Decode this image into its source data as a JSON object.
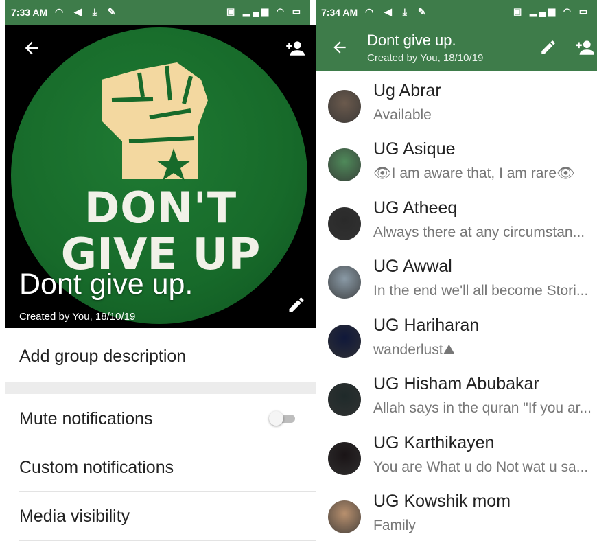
{
  "left": {
    "status_bar": {
      "time": "7:33 AM"
    },
    "poster": {
      "line1": "DON'T",
      "line2": "GIVE UP"
    },
    "group_name": "Dont give up.",
    "created": "Created by You, 18/10/19",
    "description_label": "Add group description",
    "mute_label": "Mute notifications",
    "mute_enabled": false,
    "custom_label": "Custom notifications",
    "media_label": "Media visibility"
  },
  "right": {
    "status_bar": {
      "time": "7:34 AM"
    },
    "header": {
      "title": "Dont give up.",
      "subtitle": "Created by You, 18/10/19"
    },
    "members": [
      {
        "name": "Ug Abrar",
        "status": "Available",
        "avatar_color": "#6b5a4d"
      },
      {
        "name": "UG Asique",
        "status": "👁I am aware that, I am rare👁",
        "avatar_color": "#4f8a5a"
      },
      {
        "name": "UG Atheeq",
        "status": "Always there at any circumstan...",
        "avatar_color": "#2a2a2a"
      },
      {
        "name": "UG Awwal",
        "status": "In the end we'll all become Stori...",
        "avatar_color": "#8a9aa6"
      },
      {
        "name": "UG Hariharan",
        "status": "wanderlust⛰",
        "avatar_color": "#10183a"
      },
      {
        "name": "UG Hisham Abubakar",
        "status": "Allah says in the quran \"If you ar...",
        "avatar_color": "#1f2a2a"
      },
      {
        "name": "UG Karthikayen",
        "status": "You are What u do Not wat u sa...",
        "avatar_color": "#1a1416"
      },
      {
        "name": "UG Kowshik mom",
        "status": "Family",
        "avatar_color": "#b8906e"
      }
    ]
  },
  "colors": {
    "header_green": "#3e7c4a",
    "poster_green": "#176a2a",
    "fist": "#f3d8a0"
  }
}
